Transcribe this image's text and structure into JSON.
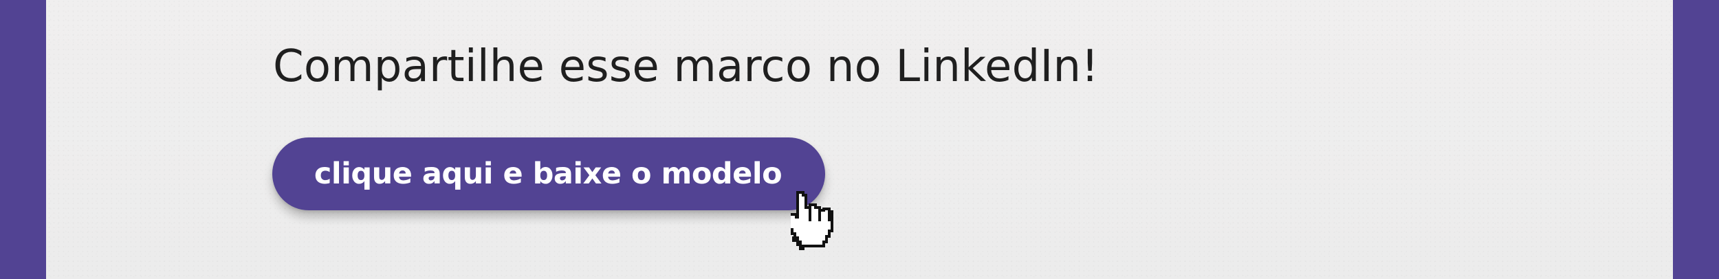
{
  "banner": {
    "headline": "Compartilhe esse marco no LinkedIn!",
    "cta_label": "clique aqui e baixe o modelo",
    "cursor_icon": "hand-pointer-icon"
  },
  "colors": {
    "accent": "#524393",
    "background": "#efeeee",
    "text": "#1f1f1f",
    "button_text": "#ffffff"
  }
}
